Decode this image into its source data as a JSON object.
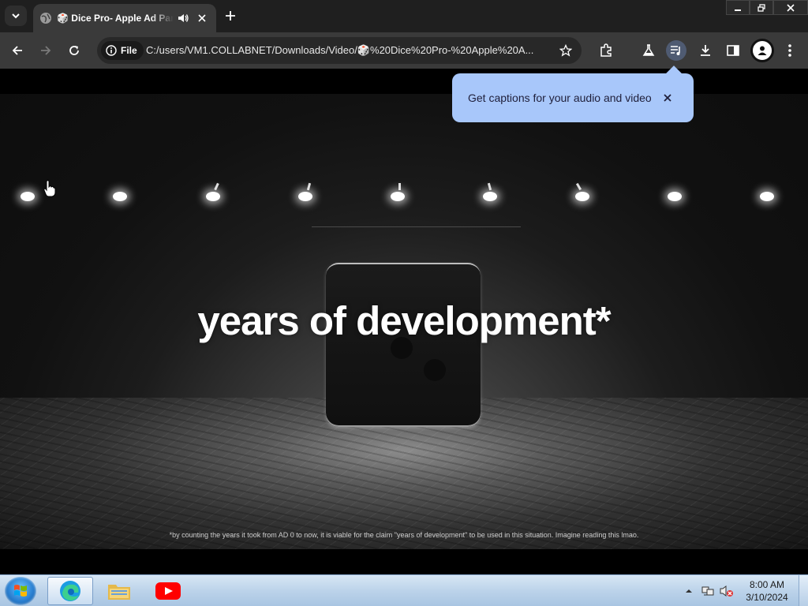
{
  "browser": {
    "tab": {
      "title": "🎲 Dice Pro- Apple Ad Parody"
    },
    "address_bar": {
      "chip_label": "File",
      "url": "C:/users/VM1.COLLABNET/Downloads/Video/🎲%20Dice%20Pro-%20Apple%20A..."
    },
    "accent": "#a8c7fa"
  },
  "popup": {
    "text": "Get captions for your audio and video"
  },
  "video": {
    "headline": "years of development*",
    "footnote": "*by counting the years it took from AD 0 to now, it is viable for the claim \"years of development\" to be used in this situation. Imagine reading this lmao."
  },
  "taskbar": {
    "time": "8:00 AM",
    "date": "3/10/2024",
    "apps": [
      "start-orb",
      "edge-browser",
      "file-explorer",
      "youtube"
    ]
  }
}
